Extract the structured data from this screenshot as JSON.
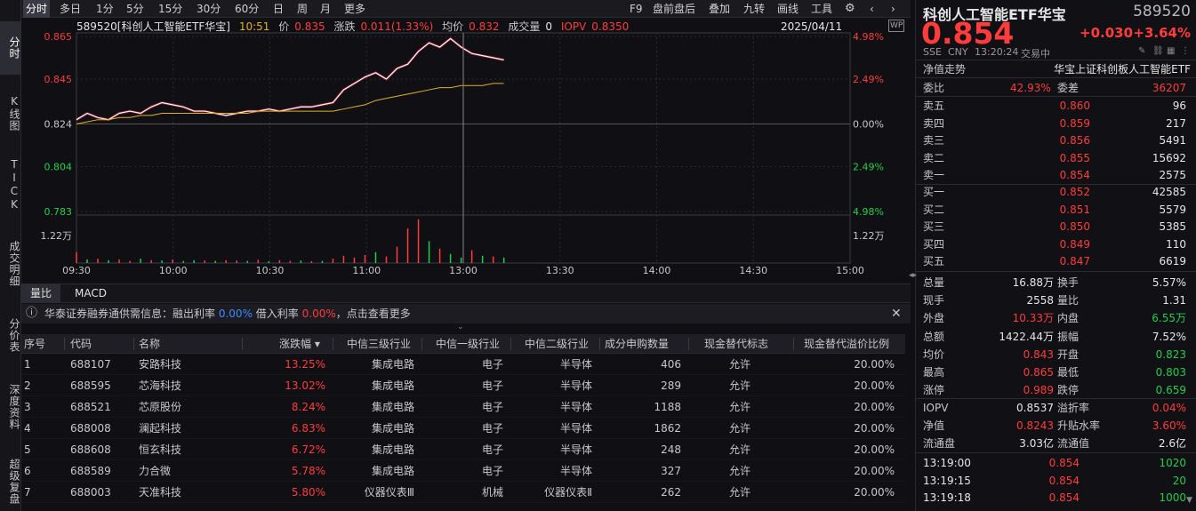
{
  "left_nav": [
    {
      "label": "分时",
      "active": true
    },
    {
      "label": "K线图",
      "active": false
    },
    {
      "label": "TICK",
      "active": false
    },
    {
      "label": "成交明细",
      "active": false
    },
    {
      "label": "分价表",
      "active": false
    },
    {
      "label": "深度资料",
      "active": false
    },
    {
      "label": "超级复盘",
      "active": false
    }
  ],
  "toolbar": {
    "periods": [
      "分时",
      "多日",
      "1分",
      "5分",
      "15分",
      "30分",
      "60分",
      "日",
      "周",
      "月",
      "更多"
    ],
    "right_items": [
      "F9",
      "盘前盘后",
      "叠加",
      "九转",
      "画线",
      "工具"
    ]
  },
  "chart_header": {
    "code_name": "589520[科创人工智能ETF华宝]",
    "time": "10:51",
    "price_label": "价",
    "price": "0.835",
    "change_label": "涨跌",
    "change": "0.011(1.33%)",
    "avg_label": "均价",
    "avg": "0.832",
    "vol_label": "成交量",
    "vol": "0",
    "iopv_label": "IOPV",
    "iopv": "0.8350",
    "date": "2025/04/11"
  },
  "chart_data": {
    "type": "line",
    "y_ticks_left": [
      "0.865",
      "0.845",
      "0.824",
      "0.804",
      "0.783"
    ],
    "y_ticks_right": [
      "4.98%",
      "2.49%",
      "0.00%",
      "2.49%",
      "4.98%"
    ],
    "ylim": [
      0.783,
      0.865
    ],
    "prev_close": 0.824,
    "x_ticks": [
      "09:30",
      "10:00",
      "10:30",
      "11:00",
      "13:00",
      "13:30",
      "14:00",
      "14:30",
      "15:00"
    ],
    "volume_label": "1.22万",
    "price_series": [
      0.826,
      0.829,
      0.827,
      0.826,
      0.829,
      0.83,
      0.829,
      0.832,
      0.834,
      0.833,
      0.832,
      0.83,
      0.83,
      0.829,
      0.828,
      0.829,
      0.83,
      0.83,
      0.831,
      0.83,
      0.831,
      0.832,
      0.832,
      0.833,
      0.834,
      0.84,
      0.843,
      0.846,
      0.848,
      0.845,
      0.85,
      0.852,
      0.858,
      0.862,
      0.86,
      0.864,
      0.86,
      0.857,
      0.856,
      0.855,
      0.854
    ],
    "avg_series": [
      0.824,
      0.825,
      0.826,
      0.826,
      0.827,
      0.827,
      0.828,
      0.828,
      0.829,
      0.829,
      0.829,
      0.829,
      0.829,
      0.829,
      0.829,
      0.829,
      0.829,
      0.83,
      0.83,
      0.83,
      0.83,
      0.83,
      0.83,
      0.83,
      0.83,
      0.831,
      0.832,
      0.833,
      0.835,
      0.836,
      0.837,
      0.838,
      0.839,
      0.84,
      0.841,
      0.841,
      0.842,
      0.842,
      0.842,
      0.843,
      0.843
    ],
    "volume_series": [
      0.3,
      0.1,
      0.12,
      0.08,
      0.1,
      0.06,
      0.12,
      0.08,
      0.07,
      0.1,
      0.06,
      0.08,
      0.07,
      0.06,
      0.08,
      0.07,
      0.06,
      0.09,
      0.05,
      0.08,
      0.06,
      0.07,
      0.05,
      0.06,
      0.12,
      0.2,
      0.15,
      0.22,
      0.3,
      0.18,
      0.45,
      0.95,
      1.2,
      0.6,
      0.4,
      0.25,
      0.15,
      0.35,
      0.2,
      0.18,
      0.15
    ],
    "volume_colors": [
      "r",
      "g",
      "r",
      "g",
      "r",
      "r",
      "g",
      "r",
      "g",
      "r",
      "g",
      "g",
      "r",
      "g",
      "r",
      "r",
      "g",
      "r",
      "g",
      "r",
      "r",
      "g",
      "r",
      "g",
      "r",
      "r",
      "r",
      "r",
      "g",
      "r",
      "r",
      "r",
      "r",
      "g",
      "r",
      "g",
      "g",
      "r",
      "g",
      "r",
      "g"
    ]
  },
  "bottom_tabs": [
    "量比",
    "MACD"
  ],
  "notice": {
    "text1": "华泰证券融券通供需信息：融出利率",
    "rate1": "0.00%",
    "text2": "借入利率",
    "rate2": "0.00%",
    "text3": "，点击查看更多"
  },
  "constituents": {
    "headers": [
      "序号",
      "代码",
      "名称",
      "涨跌幅 ▾",
      "中信三级行业",
      "中信一级行业",
      "中信二级行业",
      "成分申购数量",
      "现金替代标志",
      "现金替代溢价比例"
    ],
    "rows": [
      [
        "1",
        "688107",
        "安路科技",
        "13.25%",
        "集成电路",
        "电子",
        "半导体",
        "406",
        "允许",
        "20.00%"
      ],
      [
        "2",
        "688595",
        "芯海科技",
        "13.02%",
        "集成电路",
        "电子",
        "半导体",
        "289",
        "允许",
        "20.00%"
      ],
      [
        "3",
        "688521",
        "芯原股份",
        "8.24%",
        "集成电路",
        "电子",
        "半导体",
        "1188",
        "允许",
        "20.00%"
      ],
      [
        "4",
        "688008",
        "澜起科技",
        "6.83%",
        "集成电路",
        "电子",
        "半导体",
        "1862",
        "允许",
        "20.00%"
      ],
      [
        "5",
        "688608",
        "恒玄科技",
        "6.72%",
        "集成电路",
        "电子",
        "半导体",
        "248",
        "允许",
        "20.00%"
      ],
      [
        "6",
        "688589",
        "力合微",
        "5.78%",
        "集成电路",
        "电子",
        "半导体",
        "327",
        "允许",
        "20.00%"
      ],
      [
        "7",
        "688003",
        "天准科技",
        "5.80%",
        "仪器仪表Ⅲ",
        "机械",
        "仪器仪表Ⅱ",
        "262",
        "允许",
        "20.00%"
      ]
    ]
  },
  "quote": {
    "name": "科创人工智能ETF华宝",
    "code": "589520",
    "price": "0.854",
    "change": "+0.030",
    "change_pct": "+3.64%",
    "exchange": "SSE",
    "currency": "CNY",
    "time": "13:20:24",
    "status": "交易中",
    "nav_trend_label": "净值走势",
    "index_name": "华宝上证科创板人工智能ETF",
    "weibi_label": "委比",
    "weibi": "42.93%",
    "weicha_label": "委差",
    "weicha": "36207",
    "asks": [
      {
        "label": "卖五",
        "price": "0.860",
        "vol": "96"
      },
      {
        "label": "卖四",
        "price": "0.859",
        "vol": "217"
      },
      {
        "label": "卖三",
        "price": "0.856",
        "vol": "5491"
      },
      {
        "label": "卖二",
        "price": "0.855",
        "vol": "15692"
      },
      {
        "label": "卖一",
        "price": "0.854",
        "vol": "2575"
      }
    ],
    "bids": [
      {
        "label": "买一",
        "price": "0.852",
        "vol": "42585"
      },
      {
        "label": "买二",
        "price": "0.851",
        "vol": "5579"
      },
      {
        "label": "买三",
        "price": "0.850",
        "vol": "5385"
      },
      {
        "label": "买四",
        "price": "0.849",
        "vol": "110"
      },
      {
        "label": "买五",
        "price": "0.847",
        "vol": "6619"
      }
    ],
    "stats": [
      {
        "l1": "总量",
        "v1": "16.88万",
        "c1": "w",
        "l2": "换手",
        "v2": "5.57%",
        "c2": "w"
      },
      {
        "l1": "现手",
        "v1": "2558",
        "c1": "w",
        "l2": "量比",
        "v2": "1.31",
        "c2": "w"
      },
      {
        "l1": "外盘",
        "v1": "10.33万",
        "c1": "r",
        "l2": "内盘",
        "v2": "6.55万",
        "c2": "g"
      },
      {
        "l1": "总额",
        "v1": "1422.44万",
        "c1": "w",
        "l2": "振幅",
        "v2": "7.52%",
        "c2": "w"
      },
      {
        "l1": "均价",
        "v1": "0.843",
        "c1": "r",
        "l2": "开盘",
        "v2": "0.823",
        "c2": "g"
      },
      {
        "l1": "最高",
        "v1": "0.865",
        "c1": "r",
        "l2": "最低",
        "v2": "0.803",
        "c2": "g"
      },
      {
        "l1": "涨停",
        "v1": "0.989",
        "c1": "r",
        "l2": "跌停",
        "v2": "0.659",
        "c2": "g"
      }
    ],
    "stats2": [
      {
        "l1": "IOPV",
        "v1": "0.8537",
        "c1": "w",
        "l2": "溢折率",
        "v2": "0.04%",
        "c2": "r"
      },
      {
        "l1": "净值",
        "v1": "0.8243",
        "c1": "r",
        "l2": "升贴水率",
        "v2": "3.60%",
        "c2": "r"
      },
      {
        "l1": "流通盘",
        "v1": "3.03亿",
        "c1": "w",
        "l2": "流通值",
        "v2": "2.6亿",
        "c2": "w"
      }
    ],
    "ticks": [
      {
        "time": "13:19:00",
        "price": "0.854",
        "vol": "1020",
        "vc": "g"
      },
      {
        "time": "13:19:15",
        "price": "0.854",
        "vol": "20",
        "vc": "g"
      },
      {
        "time": "13:19:18",
        "price": "0.854",
        "vol": "1000",
        "vc": "g"
      }
    ]
  },
  "colors": {
    "up": "#ff3b3b",
    "down": "#1fcf4a",
    "avg_line": "#e0b020",
    "price_line": "#ffffff"
  }
}
